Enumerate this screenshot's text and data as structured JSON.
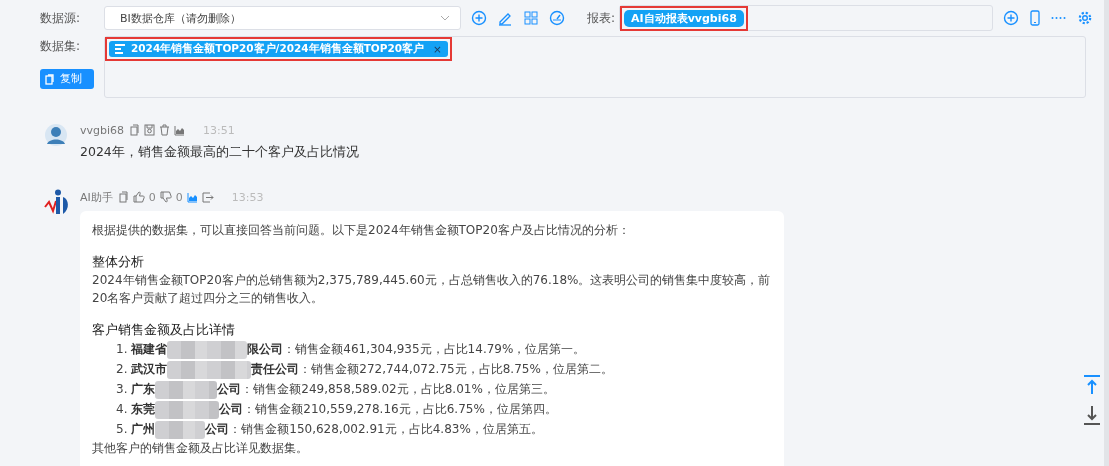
{
  "toolbar": {
    "datasource_label": "数据源:",
    "datasource_value": "BI数据仓库（请勿删除）",
    "report_label": "报表:",
    "report_tag": "AI自动报表vvgbi68",
    "report_highlighted": true,
    "dataset_label": "数据集:",
    "dataset_tag": "2024年销售金额TOP20客户/2024年销售金额TOP20客户",
    "dataset_tag_close": "×",
    "dataset_highlighted": true,
    "copy_button": "复制"
  },
  "messages": [
    {
      "kind": "user",
      "author": "vvgbi68",
      "time": "13:51",
      "text": "2024年，销售金额最高的二十个客户及占比情况"
    },
    {
      "kind": "assistant",
      "author": "AI助手",
      "likes": "0",
      "dislikes": "0",
      "time": "13:53",
      "intro": "根据提供的数据集，可以直接回答当前问题。以下是2024年销售金额TOP20客户及占比情况的分析：",
      "sections": [
        {
          "heading": "整体分析",
          "paragraph": "2024年销售金额TOP20客户的总销售额为2,375,789,445.60元，占总销售收入的76.18%。这表明公司的销售集中度较高，前20名客户贡献了超过四分之三的销售收入。"
        },
        {
          "heading": "客户销售金额及占比详情",
          "items": [
            {
              "number": "1.",
              "name_start": "福建省",
              "name_end": "限公司",
              "detail": "：销售金额461,304,935元，占比14.79%，位居第一。"
            },
            {
              "number": "2.",
              "name_start": "武汉市",
              "name_end": "责任公司",
              "detail": "：销售金额272,744,072.75元，占比8.75%，位居第二。"
            },
            {
              "number": "3.",
              "name_start": "广东",
              "name_end": "公司",
              "detail": "：销售金额249,858,589.02元，占比8.01%，位居第三。"
            },
            {
              "number": "4.",
              "name_start": "东莞",
              "name_end": "公司",
              "detail": "：销售金额210,559,278.16元，占比6.75%，位居第四。"
            },
            {
              "number": "5.",
              "name_start": "广州",
              "name_end": "公司",
              "detail": "：销售金额150,628,002.91元，占比4.83%，位居第五。"
            }
          ],
          "footer": "其他客户的销售金额及占比详见数据集。"
        }
      ]
    }
  ]
}
